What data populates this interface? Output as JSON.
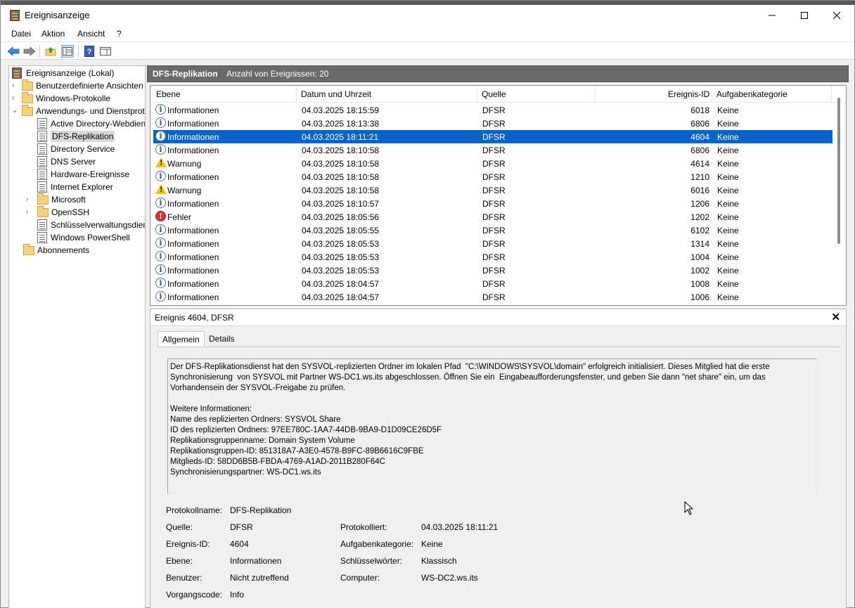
{
  "window": {
    "title": "Ereignisanzeige"
  },
  "menu": [
    "Datei",
    "Aktion",
    "Ansicht",
    "?"
  ],
  "tree": {
    "root": "Ereignisanzeige (Lokal)",
    "custom_views": "Benutzerdefinierte Ansichten",
    "windows_logs": "Windows-Protokolle",
    "app_logs": "Anwendungs- und Dienstprotokolle",
    "children": [
      "Active Directory-Webdienste",
      "DFS-Replikation",
      "Directory Service",
      "DNS Server",
      "Hardware-Ereignisse",
      "Internet Explorer",
      "Microsoft",
      "OpenSSH",
      "Schlüsselverwaltungsdienst",
      "Windows PowerShell"
    ],
    "subscriptions": "Abonnements"
  },
  "pane": {
    "title": "DFS-Replikation",
    "count": "Anzahl von Ereignissen: 20"
  },
  "columns": {
    "level": "Ebene",
    "datetime": "Datum und Uhrzeit",
    "source": "Quelle",
    "event_id": "Ereignis-ID",
    "category": "Aufgabenkategorie"
  },
  "rows": [
    {
      "level": "Informationen",
      "type": "info",
      "datetime": "04.03.2025 18:15:59",
      "source": "DFSR",
      "id": "6018",
      "category": "Keine"
    },
    {
      "level": "Informationen",
      "type": "info",
      "datetime": "04.03.2025 18:13:38",
      "source": "DFSR",
      "id": "6806",
      "category": "Keine"
    },
    {
      "level": "Informationen",
      "type": "info",
      "datetime": "04.03.2025 18:11:21",
      "source": "DFSR",
      "id": "4604",
      "category": "Keine",
      "selected": true
    },
    {
      "level": "Informationen",
      "type": "info",
      "datetime": "04.03.2025 18:10:58",
      "source": "DFSR",
      "id": "6806",
      "category": "Keine"
    },
    {
      "level": "Warnung",
      "type": "warn",
      "datetime": "04.03.2025 18:10:58",
      "source": "DFSR",
      "id": "4614",
      "category": "Keine"
    },
    {
      "level": "Informationen",
      "type": "info",
      "datetime": "04.03.2025 18:10:58",
      "source": "DFSR",
      "id": "1210",
      "category": "Keine"
    },
    {
      "level": "Warnung",
      "type": "warn",
      "datetime": "04.03.2025 18:10:58",
      "source": "DFSR",
      "id": "6016",
      "category": "Keine"
    },
    {
      "level": "Informationen",
      "type": "info",
      "datetime": "04.03.2025 18:10:57",
      "source": "DFSR",
      "id": "1206",
      "category": "Keine"
    },
    {
      "level": "Fehler",
      "type": "error",
      "datetime": "04.03.2025 18:05:56",
      "source": "DFSR",
      "id": "1202",
      "category": "Keine"
    },
    {
      "level": "Informationen",
      "type": "info",
      "datetime": "04.03.2025 18:05:55",
      "source": "DFSR",
      "id": "6102",
      "category": "Keine"
    },
    {
      "level": "Informationen",
      "type": "info",
      "datetime": "04.03.2025 18:05:53",
      "source": "DFSR",
      "id": "1314",
      "category": "Keine"
    },
    {
      "level": "Informationen",
      "type": "info",
      "datetime": "04.03.2025 18:05:53",
      "source": "DFSR",
      "id": "1004",
      "category": "Keine"
    },
    {
      "level": "Informationen",
      "type": "info",
      "datetime": "04.03.2025 18:05:53",
      "source": "DFSR",
      "id": "1002",
      "category": "Keine"
    },
    {
      "level": "Informationen",
      "type": "info",
      "datetime": "04.03.2025 18:04:57",
      "source": "DFSR",
      "id": "1008",
      "category": "Keine"
    },
    {
      "level": "Informationen",
      "type": "info",
      "datetime": "04.03.2025 18:04:57",
      "source": "DFSR",
      "id": "1006",
      "category": "Keine"
    }
  ],
  "detail": {
    "title": "Ereignis 4604, DFSR",
    "tabs": [
      "Allgemein",
      "Details"
    ],
    "description": "Der DFS-Replikationsdienst hat den SYSVOL-replizierten Ordner im lokalen Pfad  \"C:\\WINDOWS\\SYSVOL\\domain\" erfolgreich initialisiert. Dieses Mitglied hat die erste\nSynchronisierung  von SYSVOL mit Partner WS-DC1.ws.its abgeschlossen. Öffnen Sie ein  Eingabeaufforderungsfenster, und geben Sie dann \"net share\" ein, um das\nVorhandensein der SYSVOL-Freigabe zu prüfen.\n\nWeitere Informationen:\nName des replizierten Ordners: SYSVOL Share\nID des replizierten Ordners: 97EE780C-1AA7-44DB-9BA9-D1D09CE26D5F\nReplikationsgruppenname: Domain System Volume\nReplikationsgruppen-ID: 851318A7-A3E0-4578-B9FC-89B6616C9FBE\nMitglieds-ID: 58DD6B5B-FBDA-4769-A1AD-2011B280F64C\nSynchronisierungspartner: WS-DC1.ws.its",
    "props": {
      "log_name_label": "Protokollname:",
      "log_name": "DFS-Replikation",
      "source_label": "Quelle:",
      "source": "DFSR",
      "logged_label": "Protokolliert:",
      "logged": "04.03.2025 18:11:21",
      "event_id_label": "Ereignis-ID:",
      "event_id": "4604",
      "category_label": "Aufgabenkategorie:",
      "category": "Keine",
      "level_label": "Ebene:",
      "level": "Informationen",
      "keywords_label": "Schlüsselwörter:",
      "keywords": "Klassisch",
      "user_label": "Benutzer:",
      "user": "Nicht zutreffend",
      "computer_label": "Computer:",
      "computer": "WS-DC2.ws.its",
      "opcode_label": "Vorgangscode:",
      "opcode": "Info"
    }
  }
}
